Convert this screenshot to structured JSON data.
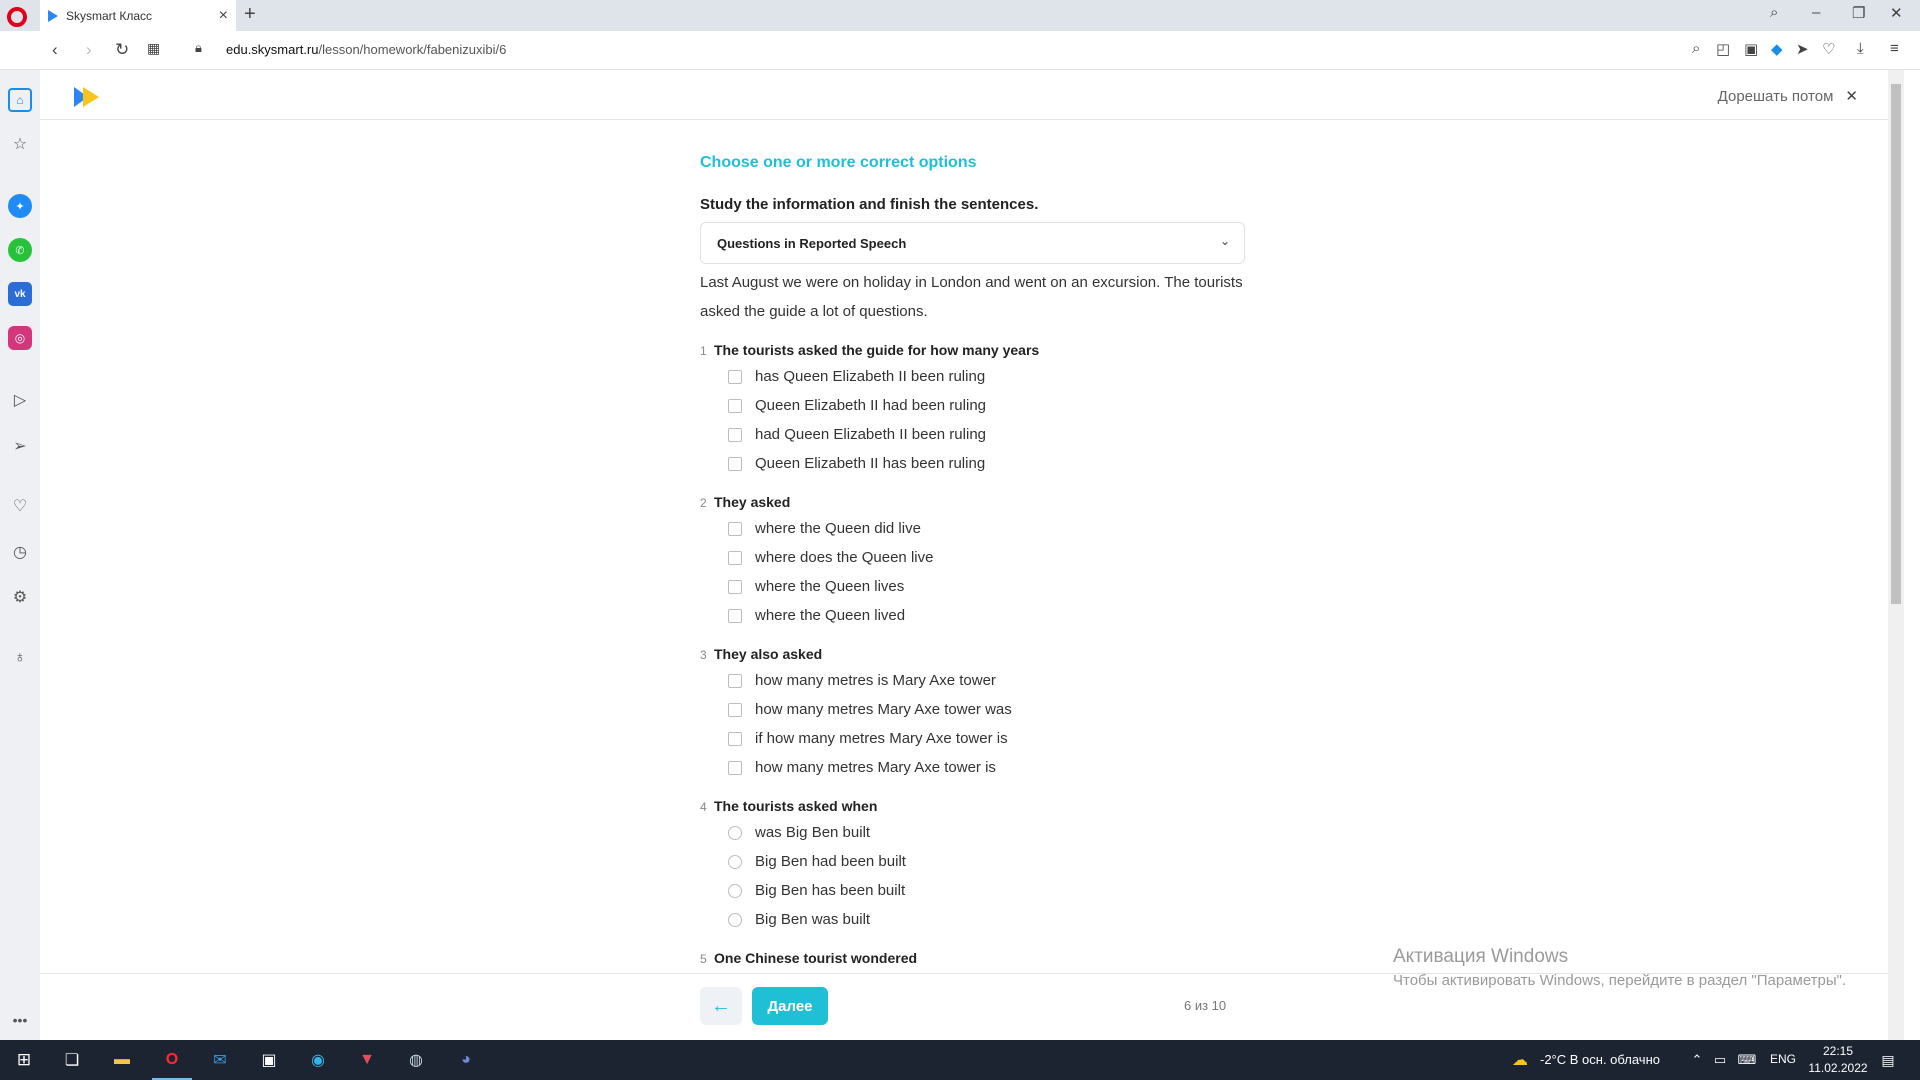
{
  "browser": {
    "tab_title": "Skysmart Класс",
    "url_domain": "edu.skysmart.ru",
    "url_path": "/lesson/homework/fabenizuxibi/6"
  },
  "header": {
    "later_label": "Дорешать потом"
  },
  "task": {
    "type_label": "Choose one or more correct options",
    "instruction": "Study the information and finish the sentences.",
    "dropdown_value": "Questions in Reported Speech",
    "passage": "Last August we were on holiday in London and went on an excursion. The tourists asked the guide a lot of questions."
  },
  "questions": [
    {
      "num": "1",
      "text": "The tourists asked the guide for how many years",
      "options": [
        "has Queen Elizabeth II been ruling",
        "Queen Elizabeth II had been ruling",
        "had Queen Elizabeth II been ruling",
        "Queen Elizabeth II has been ruling"
      ]
    },
    {
      "num": "2",
      "text": "They asked",
      "options": [
        "where the Queen did live",
        "where does the Queen live",
        "where the Queen lives",
        "where the Queen lived"
      ]
    },
    {
      "num": "3",
      "text": "They also asked",
      "options": [
        "how many metres is Mary Axe tower",
        "how many metres Mary Axe tower was",
        "if how many metres Mary Axe tower is",
        "how many metres Mary Axe tower is"
      ]
    },
    {
      "num": "4",
      "text": "The tourists asked when",
      "options": [
        "was Big Ben built",
        "Big Ben had been built",
        "Big Ben has been built",
        "Big Ben was built"
      ]
    },
    {
      "num": "5",
      "text": "One Chinese tourist wondered",
      "options": []
    }
  ],
  "footer": {
    "next_label": "Далее",
    "pager": "6 из 10"
  },
  "watermark": {
    "title": "Активация Windows",
    "subtitle": "Чтобы активировать Windows, перейдите в раздел \"Параметры\"."
  },
  "taskbar": {
    "weather": "-2°C  В осн. облачно",
    "lang": "ENG",
    "time": "22:15",
    "date": "11.02.2022"
  }
}
